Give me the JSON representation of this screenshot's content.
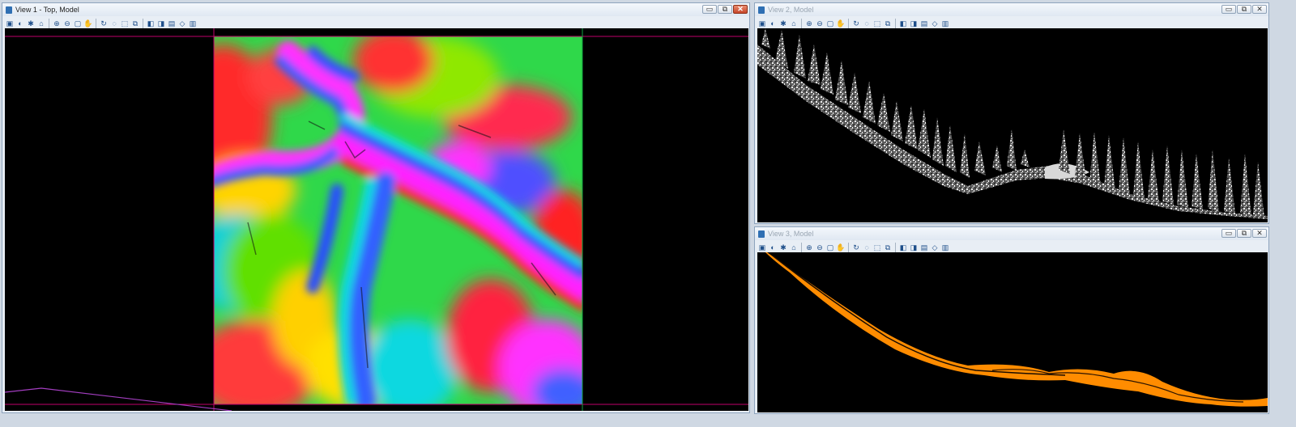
{
  "views": {
    "view1": {
      "title": "View 1 - Top, Model",
      "active": true,
      "window_buttons": [
        "▭",
        "⧉",
        "✕"
      ]
    },
    "view2": {
      "title": "View 2, Model",
      "active": false,
      "window_buttons": [
        "▭",
        "⧉",
        "✕"
      ]
    },
    "view3": {
      "title": "View 3, Model",
      "active": false,
      "window_buttons": [
        "▭",
        "⧉",
        "✕"
      ]
    }
  },
  "toolbar_icons": [
    "view-attributes-icon",
    "display-style-icon",
    "lights-icon",
    "clip-volume-icon",
    "zoom-in-icon",
    "zoom-out-icon",
    "fit-view-icon",
    "pan-icon",
    "rotate-icon",
    "walk-icon",
    "window-area-icon",
    "copy-view-icon",
    "previous-view-icon",
    "next-view-icon",
    "view-settings-icon",
    "change-view-perspective-icon",
    "camera-icon"
  ],
  "toolbar_glyphs": [
    "▣",
    "◐",
    "✱",
    "⌂",
    "⊕",
    "⊖",
    "▢",
    "✋",
    "↻",
    "◌",
    "⬚",
    "⧉",
    "◧",
    "◨",
    "▤",
    "◇",
    "▥"
  ],
  "colors": {
    "canvas_background": "#000000",
    "view3_points": "#ff8c00",
    "boundary_line": "#c0006a",
    "ground_line": "#a33ec0"
  }
}
